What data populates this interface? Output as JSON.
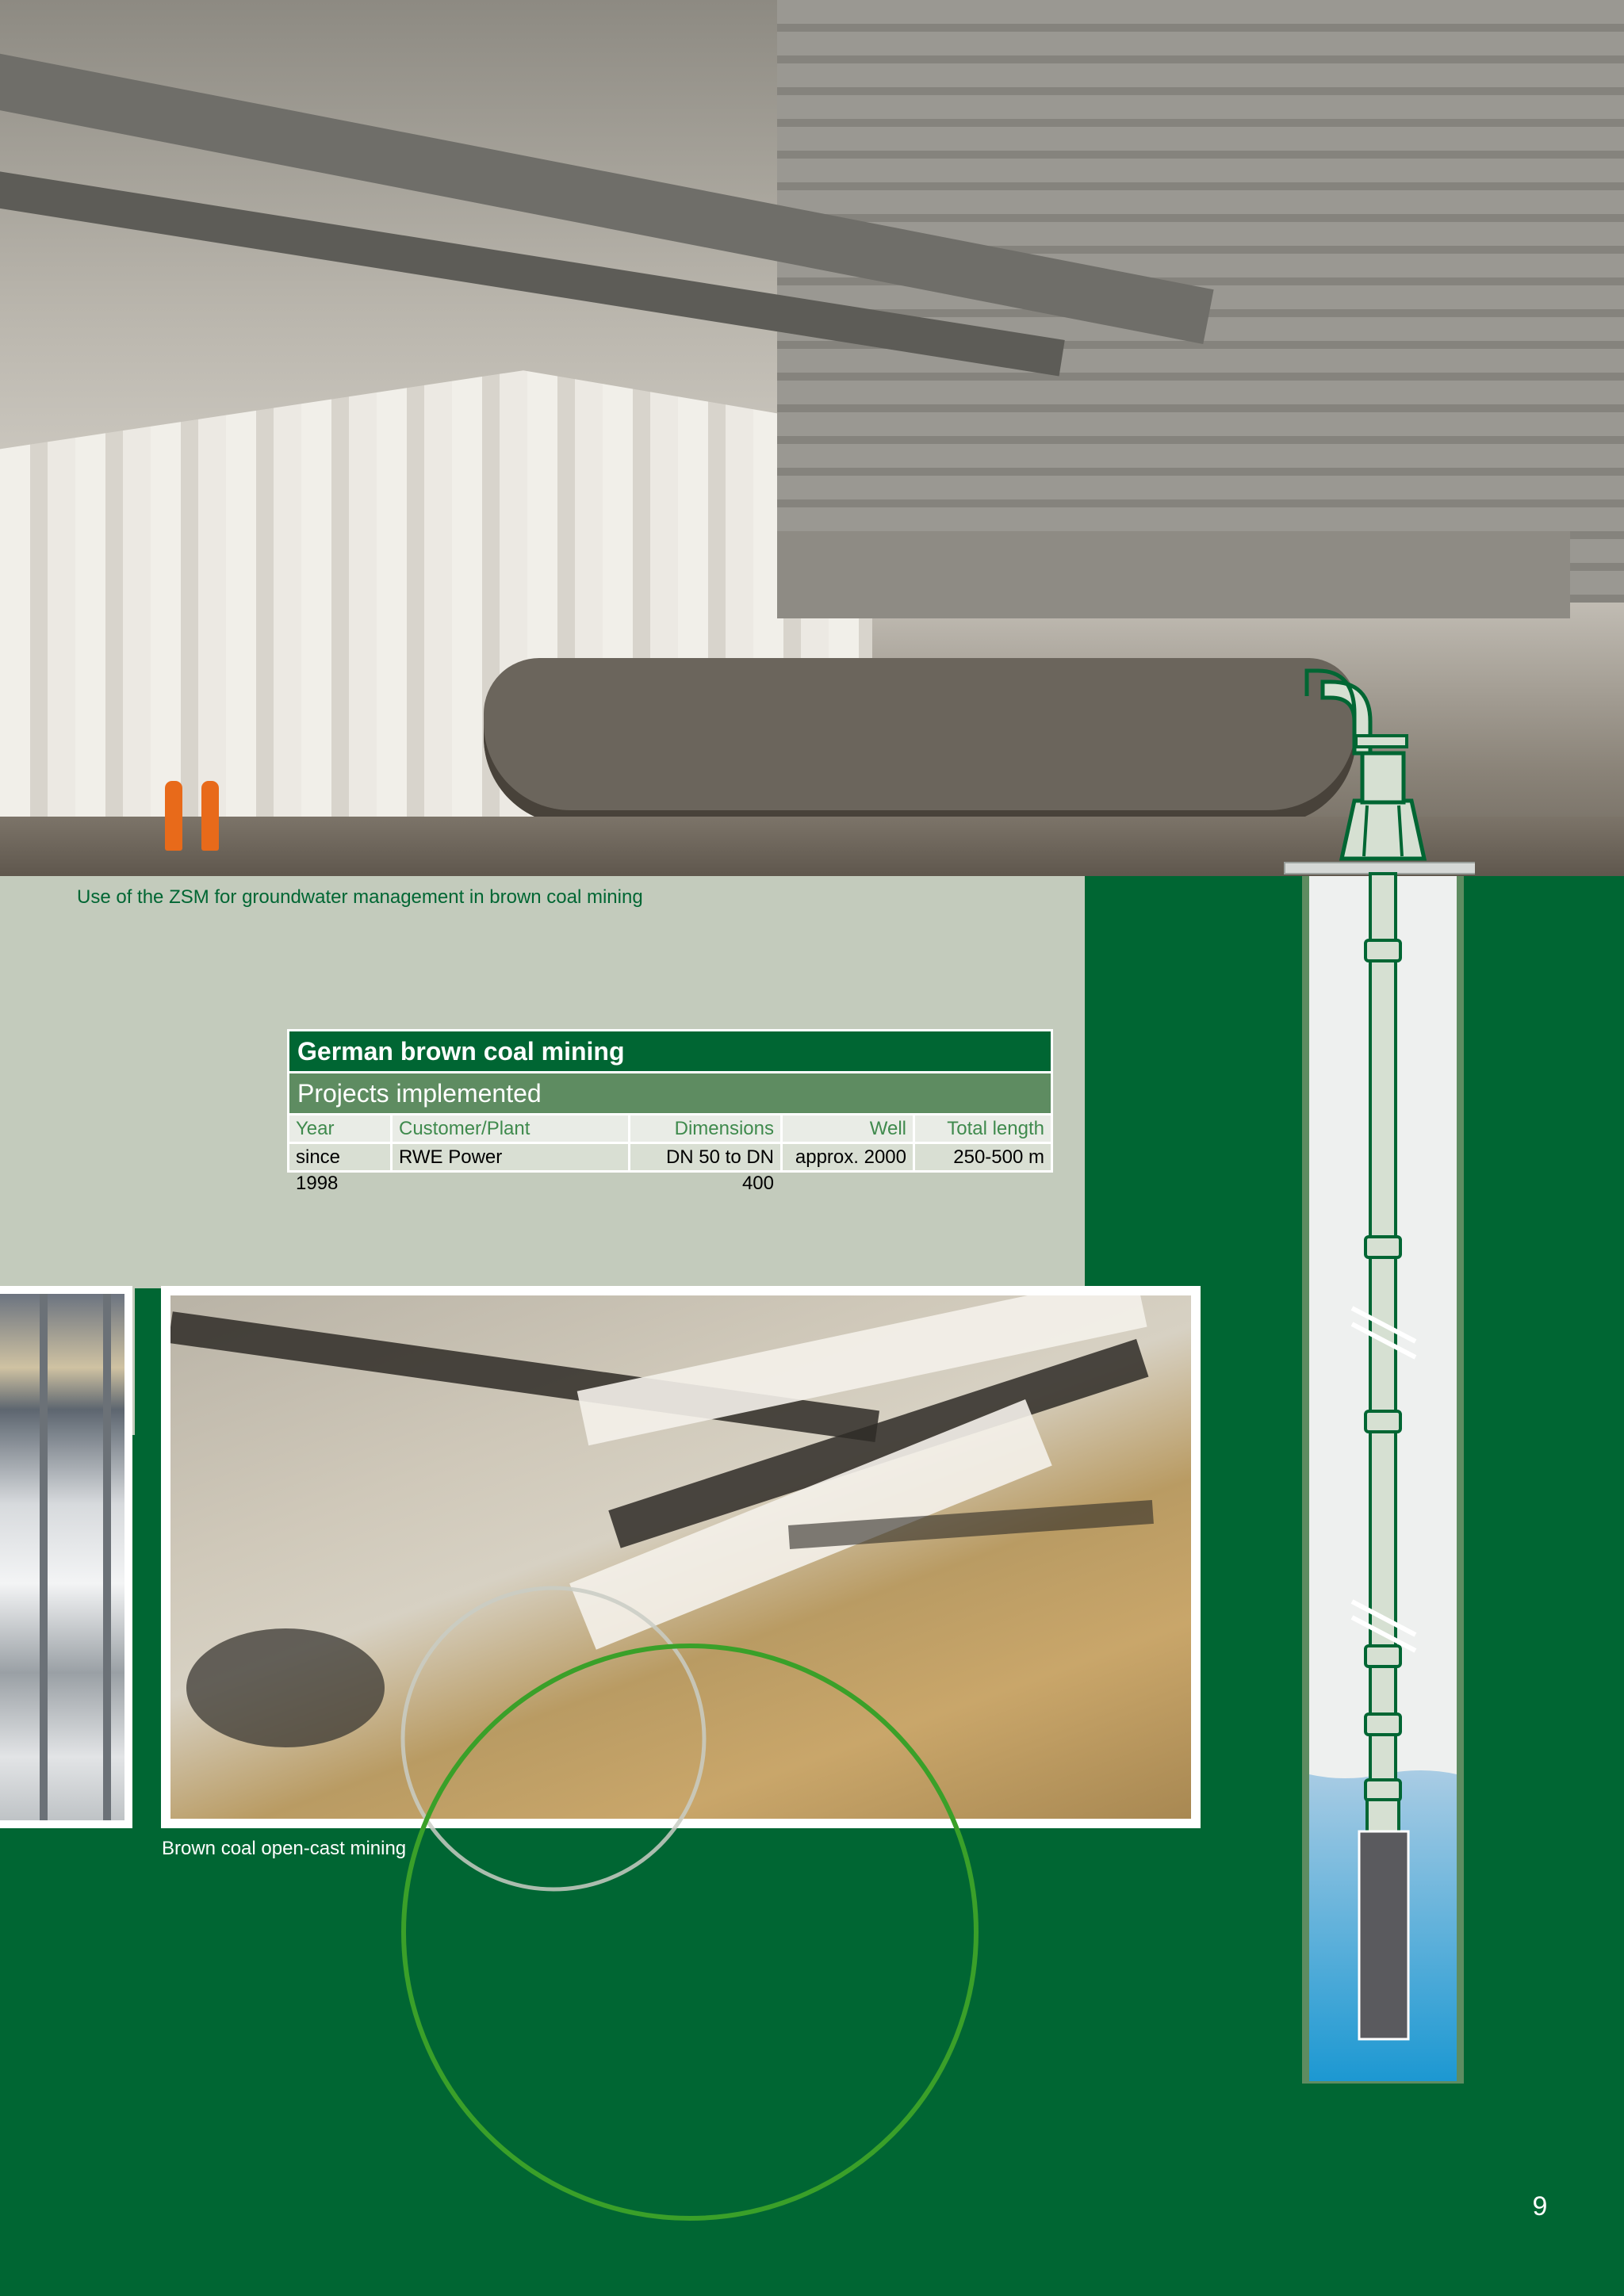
{
  "captions": {
    "top": "Use of the ZSM for groundwater management in brown coal mining",
    "bottom": "Brown coal open-cast mining"
  },
  "table": {
    "title": "German brown coal mining",
    "subtitle": "Projects implemented",
    "columns": [
      "Year",
      "Customer/Plant",
      "Dimensions",
      "Well",
      "Total length"
    ],
    "rows": [
      [
        "since 1998",
        "RWE Power",
        "DN 50 to DN 400",
        "approx. 2000",
        "250-500 m"
      ]
    ]
  },
  "page": {
    "number": "9"
  },
  "colors": {
    "brand_green": "#006633",
    "light_panel": "#c3cbbc",
    "table_subheader": "#5e8c61",
    "circle_green": "#3aa029",
    "water_blue": "#2a9fd6"
  }
}
